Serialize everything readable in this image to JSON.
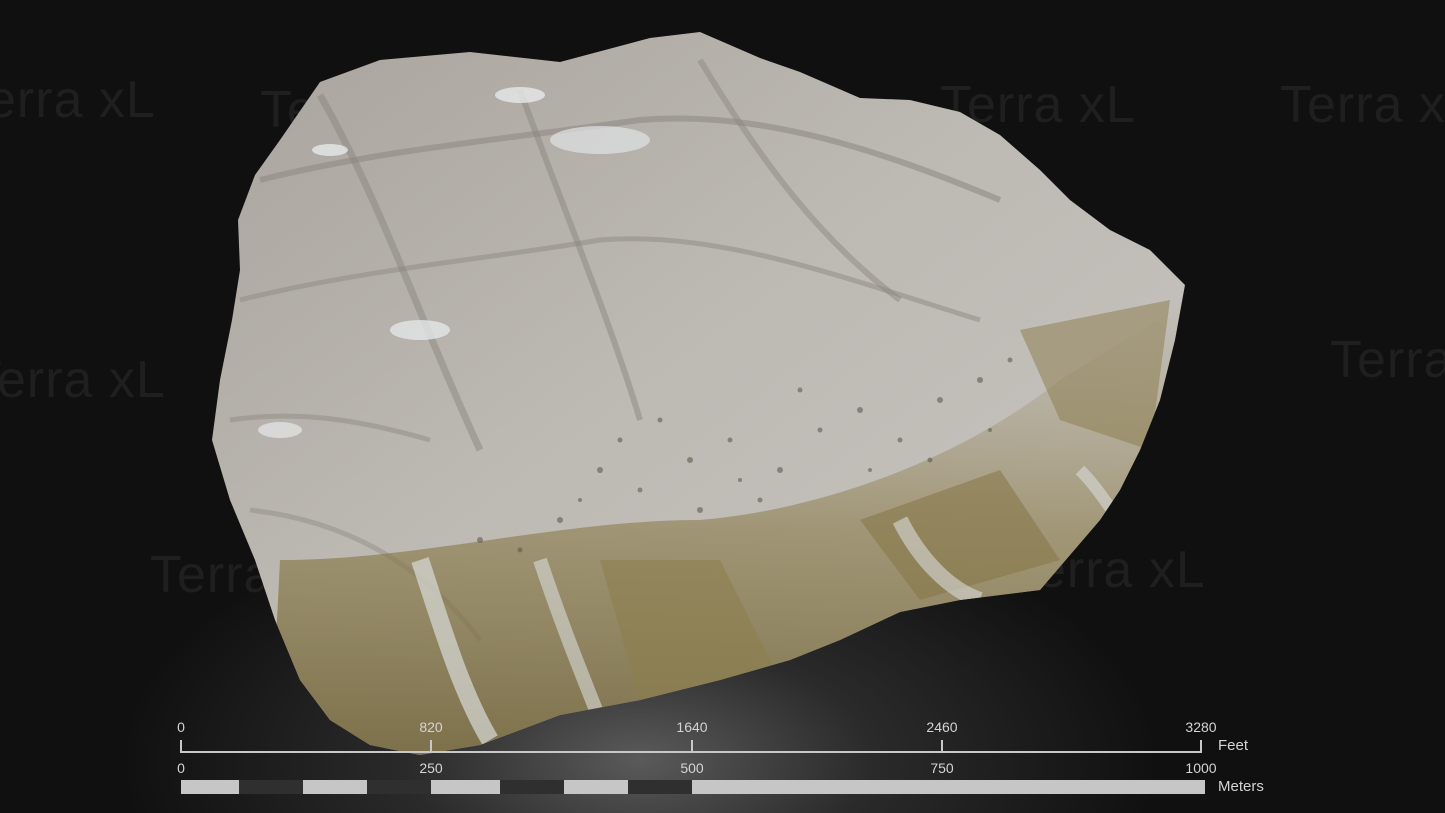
{
  "watermark": {
    "text": "Terra xL"
  },
  "map": {
    "colors": {
      "background": "#111111",
      "rock": "#b8b4ae",
      "rock_dark": "#8e8a84",
      "vegetation": "#7a6a3a",
      "snow": "#e4e6e8"
    }
  },
  "scale_bar": {
    "feet": {
      "unit_label": "Feet",
      "ticks": [
        "0",
        "820",
        "1640",
        "2460",
        "3280"
      ]
    },
    "meters": {
      "unit_label": "Meters",
      "ticks": [
        "0",
        "250",
        "500",
        "750",
        "1000"
      ],
      "segment_pattern": [
        "light",
        "dark",
        "light",
        "dark",
        "light",
        "dark",
        "light",
        "dark",
        "light"
      ]
    }
  }
}
